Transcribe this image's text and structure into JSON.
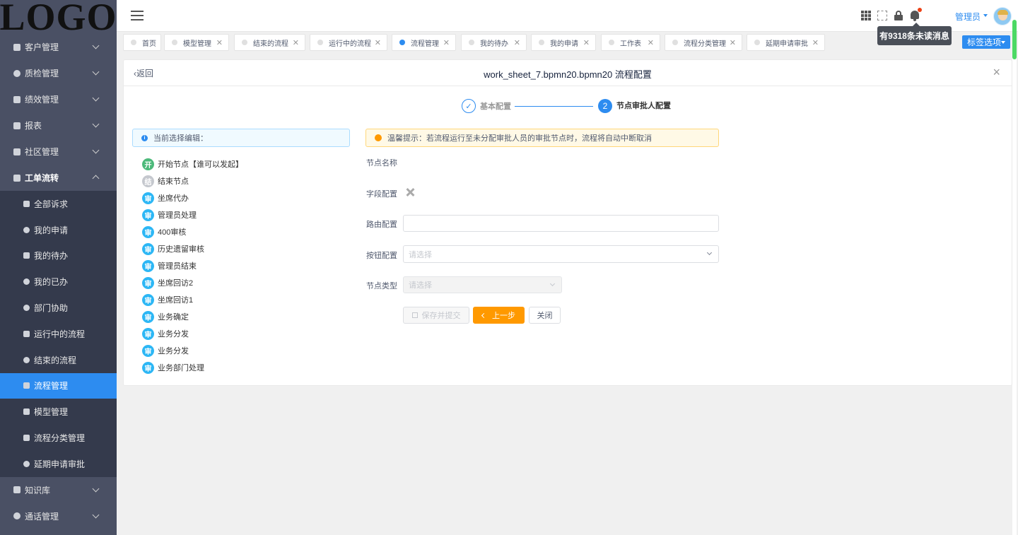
{
  "logo": "LOGO",
  "sidebar": {
    "items": [
      {
        "label": "客户管理",
        "icon": "user-icon"
      },
      {
        "label": "质检管理",
        "icon": "check-circle-icon"
      },
      {
        "label": "绩效管理",
        "icon": "chart-icon"
      },
      {
        "label": "报表",
        "icon": "table-icon"
      },
      {
        "label": "社区管理",
        "icon": "home-icon"
      },
      {
        "label": "工单流转",
        "icon": "flow-icon"
      }
    ],
    "submenu": [
      {
        "label": "全部诉求",
        "icon": "doc-icon"
      },
      {
        "label": "我的申请",
        "icon": "circle-icon"
      },
      {
        "label": "我的待办",
        "icon": "doc-icon"
      },
      {
        "label": "我的已办",
        "icon": "circle-icon"
      },
      {
        "label": "部门协助",
        "icon": "gear-icon"
      },
      {
        "label": "运行中的流程",
        "icon": "doc-icon"
      },
      {
        "label": "结束的流程",
        "icon": "circle-icon"
      },
      {
        "label": "流程管理",
        "icon": "doc-icon",
        "active": true
      },
      {
        "label": "模型管理",
        "icon": "doc-icon"
      },
      {
        "label": "流程分类管理",
        "icon": "doc-icon"
      },
      {
        "label": "延期申请审批",
        "icon": "clock-icon"
      }
    ],
    "after": [
      {
        "label": "知识库",
        "icon": "book-icon"
      },
      {
        "label": "通话管理",
        "icon": "phone-icon"
      }
    ]
  },
  "header": {
    "user_name": "管理员",
    "tooltip": "有9318条未读消息"
  },
  "tabs": [
    {
      "label": "首页",
      "closable": false
    },
    {
      "label": "模型管理",
      "closable": true
    },
    {
      "label": "结束的流程",
      "closable": true
    },
    {
      "label": "运行中的流程",
      "closable": true
    },
    {
      "label": "流程管理",
      "closable": true,
      "active": true
    },
    {
      "label": "我的待办",
      "closable": true
    },
    {
      "label": "我的申请",
      "closable": true
    },
    {
      "label": "工作表",
      "closable": true
    },
    {
      "label": "流程分类管理",
      "closable": true
    },
    {
      "label": "延期申请审批",
      "closable": true
    }
  ],
  "tag_options_label": "标签选项",
  "card": {
    "back_label": "返回",
    "title": "work_sheet_7.bpmn20.bpmn20 流程配置",
    "steps": [
      {
        "label": "基本配置",
        "status": "done"
      },
      {
        "label": "节点审批人配置",
        "number": "2",
        "status": "current"
      }
    ],
    "current_edit_label": "当前选择编辑：",
    "warning": "温馨提示：若流程运行至未分配审批人员的审批节点时，流程将自动中断取消",
    "nodes": [
      {
        "badge": "开",
        "type": "start",
        "label": "开始节点【谁可以发起】"
      },
      {
        "badge": "结",
        "type": "end",
        "label": "结束节点"
      },
      {
        "badge": "审",
        "type": "review",
        "label": "坐席代办"
      },
      {
        "badge": "审",
        "type": "review",
        "label": "管理员处理"
      },
      {
        "badge": "审",
        "type": "review",
        "label": "400审核"
      },
      {
        "badge": "审",
        "type": "review",
        "label": "历史遗留审核"
      },
      {
        "badge": "审",
        "type": "review",
        "label": "管理员结束"
      },
      {
        "badge": "审",
        "type": "review",
        "label": "坐席回访2"
      },
      {
        "badge": "审",
        "type": "review",
        "label": "坐席回访1"
      },
      {
        "badge": "审",
        "type": "review",
        "label": "业务确定"
      },
      {
        "badge": "审",
        "type": "review",
        "label": "业务分发"
      },
      {
        "badge": "审",
        "type": "review",
        "label": "业务分发"
      },
      {
        "badge": "审",
        "type": "review",
        "label": "业务部门处理"
      }
    ],
    "form": {
      "node_name_label": "节点名称",
      "field_config_label": "字段配置",
      "route_config_label": "路由配置",
      "route_config_value": "",
      "button_config_label": "按钮配置",
      "button_config_placeholder": "请选择",
      "node_type_label": "节点类型",
      "node_type_placeholder": "请选择"
    },
    "buttons": {
      "save_submit": "保存并提交",
      "prev": "上一步",
      "close": "关闭"
    }
  }
}
